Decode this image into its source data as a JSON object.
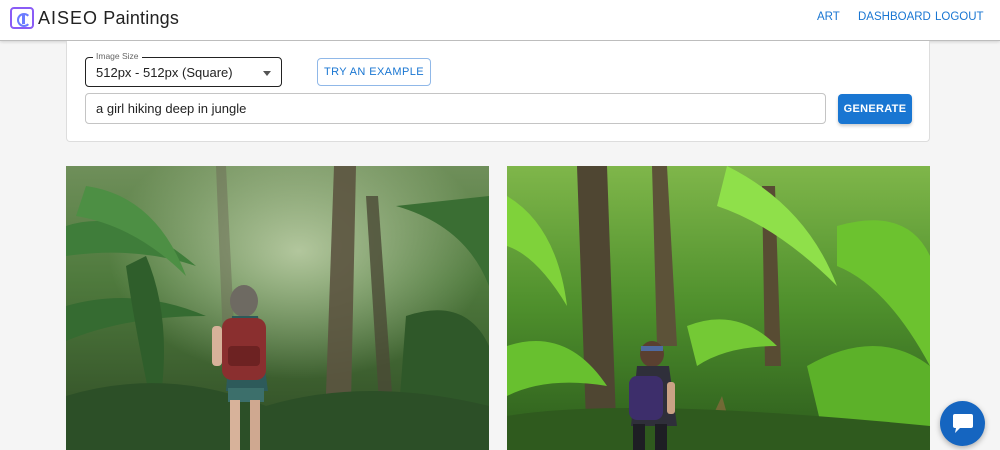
{
  "header": {
    "logo_name": "AISEO",
    "logo_suffix": "Paintings",
    "nav": {
      "art": "ART",
      "dashboard": "DASHBOARD",
      "logout": "LOGOUT"
    }
  },
  "form": {
    "image_size_label": "Image Size",
    "image_size_value": "512px - 512px (Square)",
    "try_example": "TRY AN EXAMPLE",
    "prompt_value": "a girl hiking deep in jungle",
    "generate": "GENERATE"
  },
  "results": [
    {
      "alt": "a girl hiking deep in jungle"
    },
    {
      "alt": "a girl hiking deep in jungle"
    }
  ],
  "colors": {
    "accent": "#1976d2",
    "chat": "#1565c0"
  },
  "icons": {
    "logo": "aiseo-logo-icon",
    "dropdown": "chevron-down-icon",
    "chat": "chat-icon"
  }
}
